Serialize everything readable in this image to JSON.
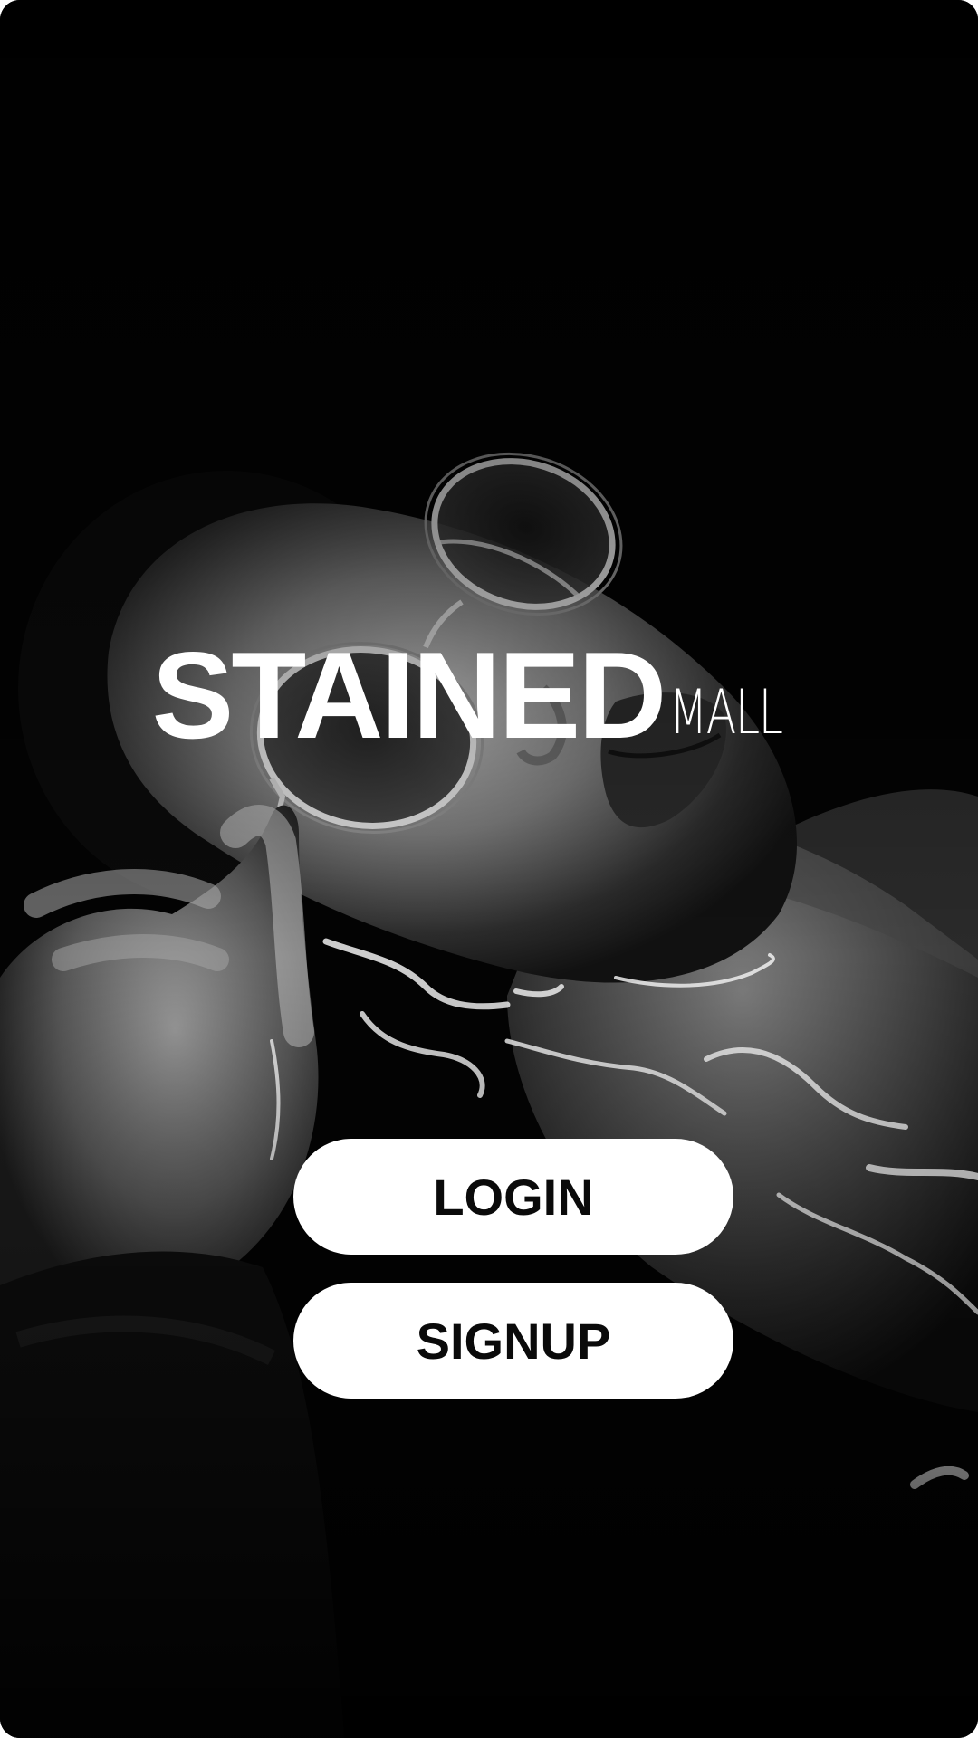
{
  "app": {
    "logo_primary": "STAINED",
    "logo_secondary": "MALL"
  },
  "actions": {
    "login_label": "LOGIN",
    "signup_label": "SIGNUP"
  },
  "background": {
    "icon": "portrait-photo",
    "colors": {
      "base": "#000000",
      "accent": "#ffffff"
    }
  }
}
